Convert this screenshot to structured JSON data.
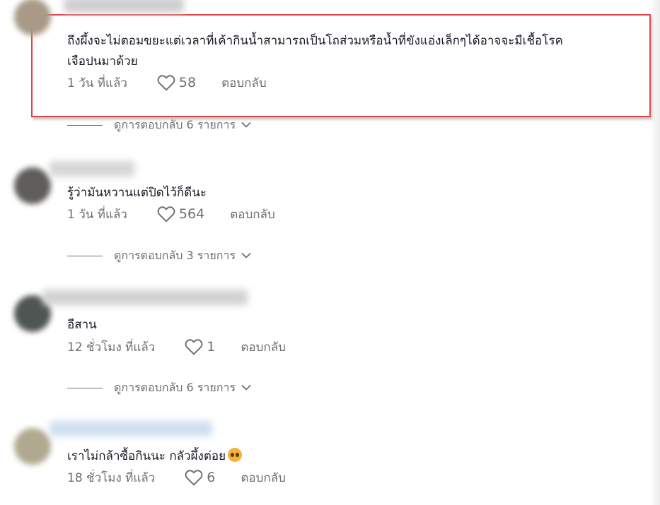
{
  "comments": [
    {
      "text_line1": "ถึงผึ้งจะไม่ตอมขยะแต่เวลาที่เค้ากินน้ำสามารถเป็นโถส่วมหรือน้ำที่ขังแอ่งเล็กๆได้อาจจะมีเชื้อโรค",
      "text_line2": "เจือปนมาด้วย",
      "time": "1 วัน ที่แล้ว",
      "likes": "58",
      "reply_label": "ตอบกลับ",
      "view_replies": "ดูการตอบกลับ 6 รายการ",
      "highlighted": true
    },
    {
      "text_line1": "รู้ว่ามันหวานแต่ปิดไว้ก็ดีนะ",
      "time": "1 วัน ที่แล้ว",
      "likes": "564",
      "reply_label": "ตอบกลับ",
      "view_replies": "ดูการตอบกลับ 3 รายการ"
    },
    {
      "text_line1": "อีสาน",
      "time": "12 ชั่วโมง ที่แล้ว",
      "likes": "1",
      "reply_label": "ตอบกลับ",
      "view_replies": "ดูการตอบกลับ 6 รายการ"
    },
    {
      "text_line1": "เราไม่กล้าซื้อกินนะ กลัวผึ้งต่อย",
      "emoji": "pleading-face-emoji",
      "time": "18 ชั่วโมง ที่แล้ว",
      "likes": "6",
      "reply_label": "ตอบกลับ"
    }
  ],
  "icons": {
    "like": "heart-outline-icon",
    "expand": "chevron-down-icon"
  },
  "colors": {
    "highlight_border": "#e0454b",
    "text_primary": "#161823",
    "text_secondary": "#6e6f74"
  }
}
